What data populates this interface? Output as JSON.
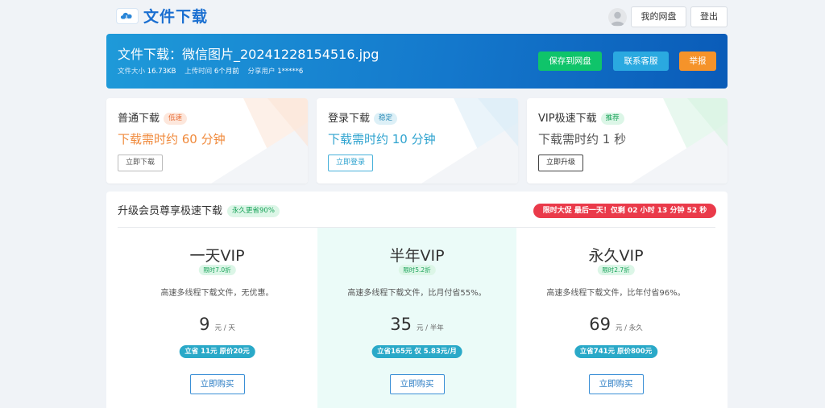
{
  "header": {
    "brand": "文件下载",
    "logo_icon": "cloud-download-logo",
    "my_disk_label": "我的网盘",
    "logout_label": "登出"
  },
  "banner": {
    "title": "文件下载：微信图片_20241228154516.jpg",
    "size_label": "文件大小",
    "size_value": "16.73KB",
    "upload_label": "上传时间",
    "upload_value": "6个月前",
    "share_label": "分享用户",
    "share_value": "1*****6",
    "save_label": "保存到网盘",
    "service_label": "联系客服",
    "report_label": "举报",
    "colors": {
      "save": "#0fc46a",
      "service": "#2aa9e0",
      "report": "#f5932a"
    }
  },
  "download_options": [
    {
      "name": "普通下载",
      "badge": "低速",
      "time": "下载需时约 60 分钟",
      "button": "立即下载"
    },
    {
      "name": "登录下载",
      "badge": "稳定",
      "time": "下载需时约 10 分钟",
      "button": "立即登录"
    },
    {
      "name": "VIP极速下载",
      "badge": "推荐",
      "time": "下载需时约 1 秒",
      "button": "立即升级"
    }
  ],
  "vip": {
    "heading": "升级会员尊享极速下载",
    "heading_badge": "永久更省90%",
    "promo": "限时大促 最后一天！仅剩 02 小时 13 分钟 52 秒",
    "plans": [
      {
        "name": "一天VIP",
        "discount": "限时7.0折",
        "desc": "高速多线程下载文件，无优惠。",
        "price": "9",
        "unit": "元 / 天",
        "save": "立省 11元 原价20元",
        "buy": "立即购买"
      },
      {
        "name": "半年VIP",
        "discount": "限时5.2折",
        "desc": "高速多线程下载文件，比月付省55%。",
        "price": "35",
        "unit": "元 / 半年",
        "save": "立省165元 仅 5.83元/月",
        "buy": "立即购买"
      },
      {
        "name": "永久VIP",
        "discount": "限时2.7折",
        "desc": "高速多线程下载文件，比年付省96%。",
        "price": "69",
        "unit": "元 / 永久",
        "save": "立省741元 原价800元",
        "buy": "立即购买"
      }
    ]
  }
}
